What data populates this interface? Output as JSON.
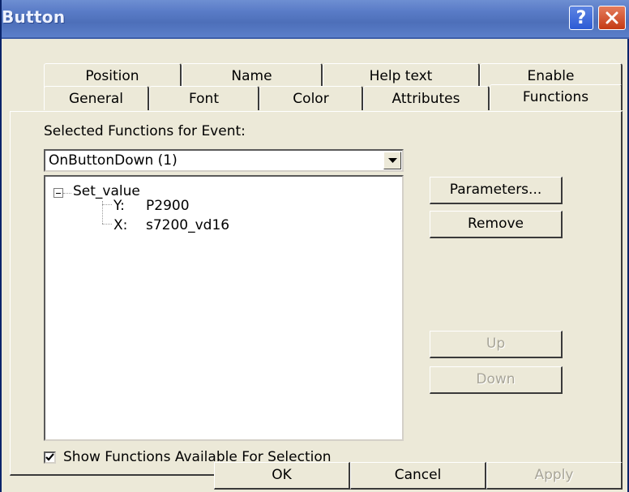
{
  "window": {
    "title": "Button"
  },
  "titlebar": {
    "help_glyph": "?",
    "help_icon": "help-icon",
    "close_icon": "close-icon"
  },
  "tabs": {
    "back": [
      "Position",
      "Name",
      "Help text",
      "Enable"
    ],
    "front": [
      "General",
      "Font",
      "Color",
      "Attributes",
      "Functions"
    ],
    "active": "Functions"
  },
  "functions": {
    "selected_label": "Selected Functions for Event:",
    "event_combo_value": "OnButtonDown  (1)",
    "tree": {
      "root": "Set_value",
      "children": [
        {
          "key": "Y:",
          "value": "P2900"
        },
        {
          "key": "X:",
          "value": "s7200_vd16"
        }
      ]
    },
    "buttons": {
      "parameters": "Parameters...",
      "remove": "Remove",
      "up": "Up",
      "down": "Down"
    },
    "show_available_label": "Show Functions Available For Selection",
    "show_available_checked": true
  },
  "footer": {
    "ok": "OK",
    "cancel": "Cancel",
    "apply": "Apply"
  },
  "colors": {
    "titlebar": "#5a7cc7",
    "dialog_bg": "#ece9d8",
    "disabled_text": "#a8a598"
  }
}
